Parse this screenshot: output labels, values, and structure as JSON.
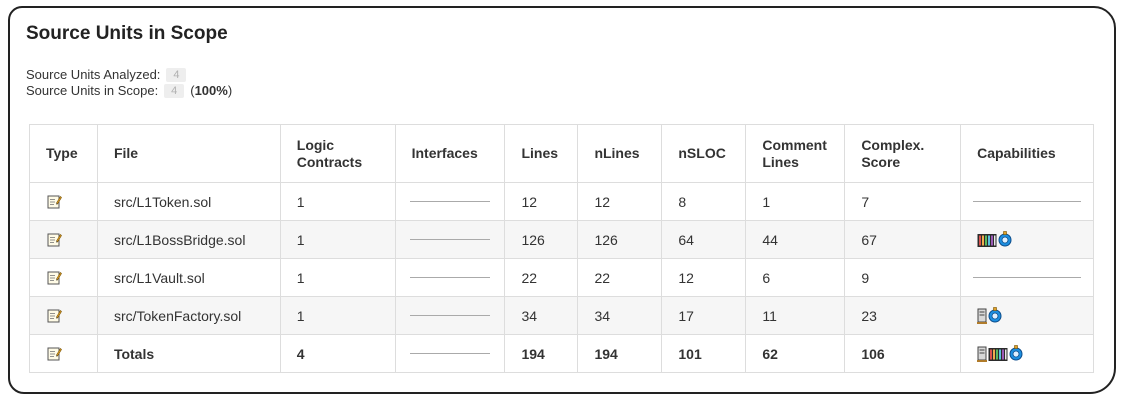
{
  "page": {
    "title": "Source Units in Scope",
    "analyzed_label": "Source Units Analyzed:",
    "analyzed_count": "4",
    "scope_label": "Source Units in Scope:",
    "scope_count": "4",
    "scope_pct_open": "(",
    "scope_pct": "100%",
    "scope_pct_close": ")"
  },
  "table": {
    "headers": [
      "Type",
      "File",
      "Logic Contracts",
      "Interfaces",
      "Lines",
      "nLines",
      "nSLOC",
      "Comment Lines",
      "Complex. Score",
      "Capabilities"
    ],
    "rows": [
      {
        "file": "src/L1Token.sol",
        "logic": "1",
        "lines": "12",
        "nlines": "12",
        "nsloc": "8",
        "comment": "1",
        "complex": "7",
        "capabilities": []
      },
      {
        "file": "src/L1BossBridge.sol",
        "logic": "1",
        "lines": "126",
        "nlines": "126",
        "nsloc": "64",
        "comment": "44",
        "complex": "67",
        "capabilities": [
          "bytes-icon",
          "hash-icon"
        ]
      },
      {
        "file": "src/L1Vault.sol",
        "logic": "1",
        "lines": "22",
        "nlines": "22",
        "nsloc": "12",
        "comment": "6",
        "complex": "9",
        "capabilities": []
      },
      {
        "file": "src/TokenFactory.sol",
        "logic": "1",
        "lines": "34",
        "nlines": "34",
        "nsloc": "17",
        "comment": "11",
        "complex": "23",
        "capabilities": [
          "server-icon",
          "hash-icon"
        ]
      }
    ],
    "totals": {
      "file": "Totals",
      "logic": "4",
      "lines": "194",
      "nlines": "194",
      "nsloc": "101",
      "comment": "62",
      "complex": "106",
      "capabilities": [
        "server-icon",
        "bytes-icon",
        "hash-icon"
      ]
    }
  },
  "icons": {
    "type_icon": "memo-icon"
  }
}
